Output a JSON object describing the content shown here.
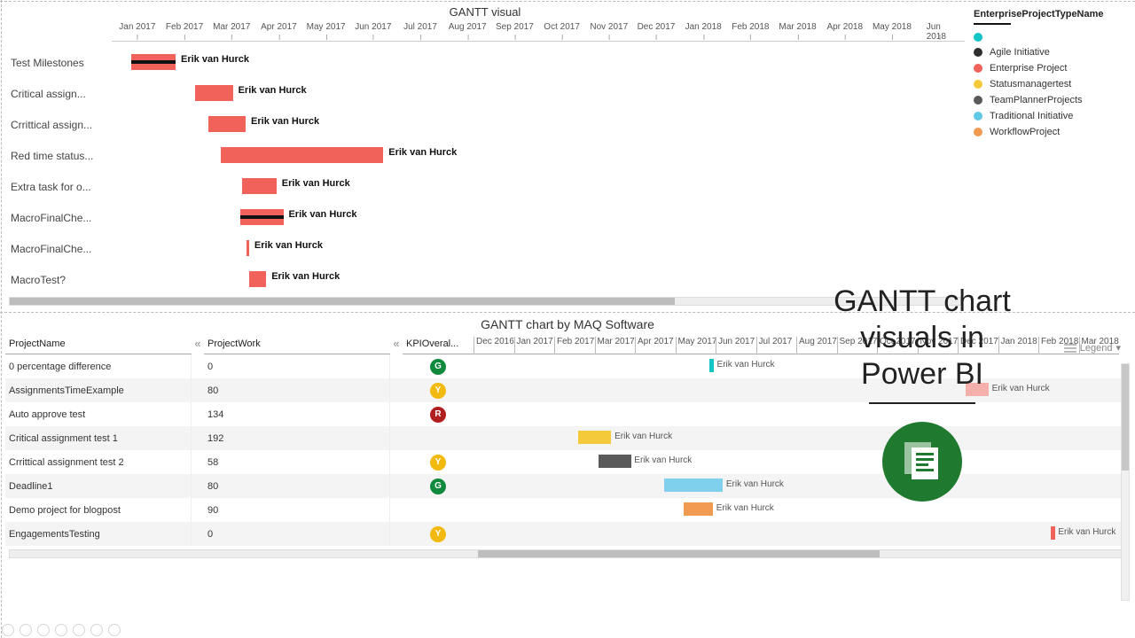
{
  "chart_data": [
    {
      "type": "gantt",
      "title": "GANTT visual",
      "x_axis_months": [
        "Jan 2017",
        "Feb 2017",
        "Mar 2017",
        "Apr 2017",
        "May 2017",
        "Jun 2017",
        "Jul 2017",
        "Aug 2017",
        "Sep 2017",
        "Oct 2017",
        "Nov 2017",
        "Dec 2017",
        "Jan 2018",
        "Feb 2018",
        "Mar 2018",
        "Apr 2018",
        "May 2018",
        "Jun 2018"
      ],
      "legend_title": "EnterpriseProjectTypeName",
      "legend": [
        {
          "name": "",
          "color": "#12c4c4"
        },
        {
          "name": "Agile Initiative",
          "color": "#2f2f2f"
        },
        {
          "name": "Enterprise Project",
          "color": "#f1625a"
        },
        {
          "name": "Statusmanagertest",
          "color": "#f4c93a"
        },
        {
          "name": "TeamPlannerProjects",
          "color": "#5a5a5a"
        },
        {
          "name": "Traditional Initiative",
          "color": "#63c8e5"
        },
        {
          "name": "WorkflowProject",
          "color": "#f19a52"
        }
      ],
      "tasks": [
        {
          "label": "Test Milestones",
          "resource": "Erik van Hurck",
          "start": "Jan 2017",
          "end": "Feb 2017",
          "color": "#f1625a",
          "has_progress_line": true,
          "start_pct": 2.5,
          "width_pct": 5.2
        },
        {
          "label": "Critical assign...",
          "resource": "Erik van Hurck",
          "start": "Feb 2017",
          "end": "Mar 2017",
          "color": "#f1625a",
          "has_progress_line": false,
          "start_pct": 10.0,
          "width_pct": 4.4
        },
        {
          "label": "Crrittical assign...",
          "resource": "Erik van Hurck",
          "start": "Feb 2017",
          "end": "Mar 2017",
          "color": "#f1625a",
          "has_progress_line": false,
          "start_pct": 11.5,
          "width_pct": 4.4
        },
        {
          "label": "Red time status...",
          "resource": "Erik van Hurck",
          "start": "Mar 2017",
          "end": "Jun 2017",
          "color": "#f1625a",
          "has_progress_line": false,
          "start_pct": 13.0,
          "width_pct": 19.0
        },
        {
          "label": "Extra task for o...",
          "resource": "Erik van Hurck",
          "start": "Mar 2017",
          "end": "Apr 2017",
          "color": "#f1625a",
          "has_progress_line": false,
          "start_pct": 15.5,
          "width_pct": 4.0
        },
        {
          "label": "MacroFinalChe...",
          "resource": "Erik van Hurck",
          "start": "Mar 2017",
          "end": "Apr 2017",
          "color": "#f1625a",
          "has_progress_line": true,
          "start_pct": 15.3,
          "width_pct": 5.0
        },
        {
          "label": "MacroFinalChe...",
          "resource": "Erik van Hurck",
          "start": "Apr 2017",
          "end": "Apr 2017",
          "color": "#f1625a",
          "has_progress_line": false,
          "start_pct": 16.0,
          "width_pct": 0.3
        },
        {
          "label": "MacroTest?",
          "resource": "Erik van Hurck",
          "start": "Apr 2017",
          "end": "Apr 2017",
          "color": "#f1625a",
          "has_progress_line": false,
          "start_pct": 16.3,
          "width_pct": 2.0
        }
      ]
    },
    {
      "type": "gantt-table",
      "title": "GANTT chart by MAQ Software",
      "columns": [
        "ProjectName",
        "ProjectWork",
        "KPIOveral..."
      ],
      "x_axis_months": [
        "Dec 2016",
        "Jan 2017",
        "Feb 2017",
        "Mar 2017",
        "Apr 2017",
        "May 2017",
        "Jun 2017",
        "Jul 2017",
        "Aug 2017",
        "Sep 2017",
        "Oct 2017",
        "Nov 2017",
        "Dec 2017",
        "Jan 2018",
        "Feb 2018",
        "Mar 2018"
      ],
      "kpi_states": {
        "G": "#0f8a3c",
        "Y": "#f2b90f",
        "R": "#b11f1f"
      },
      "rows": [
        {
          "project": "0 percentage difference",
          "work": "0",
          "kpi": "G",
          "bar": {
            "start_pct": 36.0,
            "width_pct": 0.6,
            "color": "#12c4c4"
          },
          "resource": "Erik van Hurck"
        },
        {
          "project": "AssignmentsTimeExample",
          "work": "80",
          "kpi": "Y",
          "bar": {
            "start_pct": 75.0,
            "width_pct": 3.5,
            "color": "#f6b0ab"
          },
          "resource": "Erik van Hurck"
        },
        {
          "project": "Auto approve test",
          "work": "134",
          "kpi": "R",
          "bar": null,
          "resource": ""
        },
        {
          "project": "Critical assignment test 1",
          "work": "192",
          "kpi": "",
          "bar": {
            "start_pct": 16.0,
            "width_pct": 5.0,
            "color": "#f4c93a"
          },
          "resource": "Erik van Hurck"
        },
        {
          "project": "Crrittical assignment test 2",
          "work": "58",
          "kpi": "Y",
          "bar": {
            "start_pct": 19.0,
            "width_pct": 5.0,
            "color": "#5a5a5a"
          },
          "resource": "Erik van Hurck"
        },
        {
          "project": "Deadline1",
          "work": "80",
          "kpi": "G",
          "bar": {
            "start_pct": 29.0,
            "width_pct": 9.0,
            "color": "#7fd0ec"
          },
          "resource": "Erik van Hurck"
        },
        {
          "project": "Demo project for blogpost",
          "work": "90",
          "kpi": "",
          "bar": {
            "start_pct": 32.0,
            "width_pct": 4.5,
            "color": "#f19a52"
          },
          "resource": "Erik van Hurck"
        },
        {
          "project": "EngagementsTesting",
          "work": "0",
          "kpi": "Y",
          "bar": {
            "start_pct": 88.0,
            "width_pct": 0.6,
            "color": "#f1625a"
          },
          "resource": "Erik van Hurck"
        }
      ],
      "legend_button": "Legend"
    }
  ],
  "overlay": {
    "line1": "GANTT chart",
    "line2": "visuals in",
    "line3": "Power BI"
  }
}
